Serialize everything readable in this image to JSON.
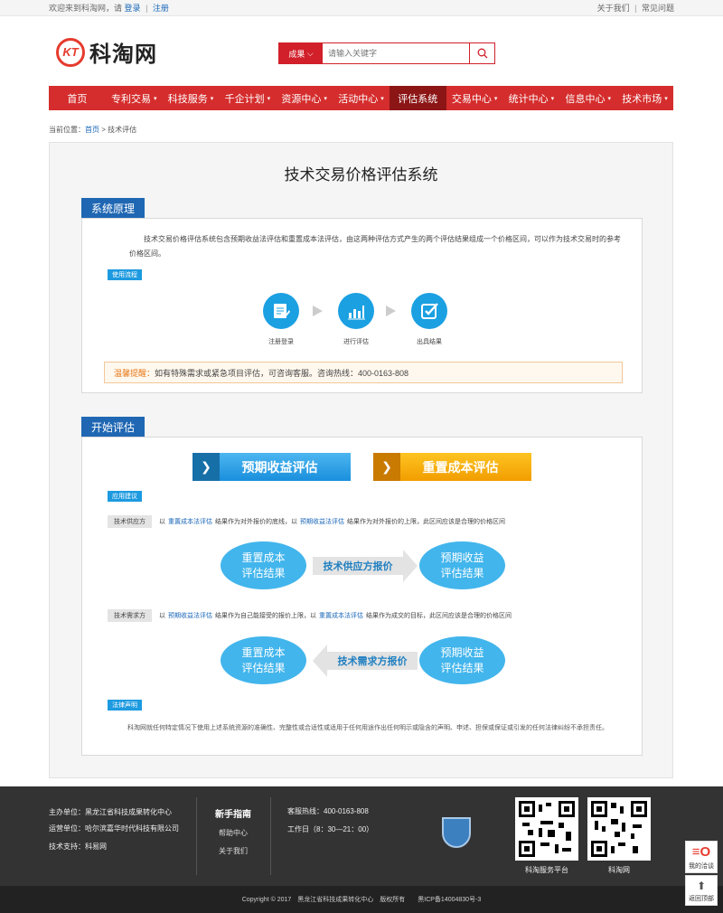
{
  "topbar": {
    "welcome": "欢迎来到科淘网，请",
    "login": "登录",
    "sep": "|",
    "register": "注册",
    "about": "关于我们",
    "faq": "常见问题"
  },
  "logo": {
    "mark": "KT",
    "name": "科淘网"
  },
  "search": {
    "category": "成果",
    "placeholder": "请输入关键字"
  },
  "nav": [
    {
      "label": "首页",
      "caret": false,
      "active": false
    },
    {
      "label": "专利交易",
      "caret": true,
      "active": false
    },
    {
      "label": "科技服务",
      "caret": true,
      "active": false
    },
    {
      "label": "千企计划",
      "caret": true,
      "active": false
    },
    {
      "label": "资源中心",
      "caret": true,
      "active": false
    },
    {
      "label": "活动中心",
      "caret": true,
      "active": false
    },
    {
      "label": "评估系统",
      "caret": false,
      "active": true
    },
    {
      "label": "交易中心",
      "caret": true,
      "active": false
    },
    {
      "label": "统计中心",
      "caret": true,
      "active": false
    },
    {
      "label": "信息中心",
      "caret": true,
      "active": false
    },
    {
      "label": "技术市场",
      "caret": true,
      "active": false
    }
  ],
  "breadcrumb": {
    "prefix": "当前位置：",
    "home": "首页",
    "sep": " > ",
    "current": "技术评估"
  },
  "main": {
    "title": "技术交易价格评估系统",
    "principle": {
      "tab": "系统原理",
      "desc": "技术交易价格评估系统包含预期收益法评估和重置成本法评估，由这两种评估方式产生的两个评估结果组成一个价格区间，可以作为技术交易时的参考价格区间。",
      "flow_tag": "使用流程",
      "steps": [
        {
          "label": "注册登录",
          "icon": "register-icon"
        },
        {
          "label": "进行评估",
          "icon": "bar-chart-icon"
        },
        {
          "label": "出具结果",
          "icon": "checkbox-icon"
        }
      ],
      "tips_key": "温馨提醒：",
      "tips_text": "如有特殊需求或紧急项目评估，可咨询客服。咨询热线：400-0163-808"
    },
    "start": {
      "tab": "开始评估",
      "btn_expected": "预期收益评估",
      "btn_reset": "重置成本评估",
      "advice_tag": "应用建议",
      "supplier": {
        "role": "技术供应方",
        "t1": "以",
        "l1": "重置成本法评估",
        "t2": "结果作为对外报价的底线，以",
        "l2": "预期收益法评估",
        "t3": "结果作为对外报价的上限，此区间应该是合理的价格区间"
      },
      "demander": {
        "role": "技术需求方",
        "t1": "以",
        "l1": "预期收益法评估",
        "t2": "结果作为自己能接受的报价上限，以",
        "l2": "重置成本法评估",
        "t3": "结果作为成交的目标，此区间应该是合理的价格区间"
      },
      "diagram1": {
        "left": [
          "重置成本",
          "评估结果"
        ],
        "arrow": "技术供应方报价",
        "right": [
          "预期收益",
          "评估结果"
        ]
      },
      "diagram2": {
        "left": [
          "重置成本",
          "评估结果"
        ],
        "arrow": "技术需求方报价",
        "right": [
          "预期收益",
          "评估结果"
        ]
      },
      "law_tag": "法律声明",
      "law_text": "科淘网就任何特定情况下使用上述系统资源的准确性、完整性或合适性或适用于任何用途作出任何明示或隐含的声明、申述、担保或保证或引发的任何法律纠纷不承担责任。"
    }
  },
  "footer": {
    "host_label": "主办单位：",
    "host": "黑龙江省科技成果转化中心",
    "operator_label": "运营单位：",
    "operator": "哈尔滨嘉华时代科技有限公司",
    "support_label": "技术支持：",
    "support": "科易网",
    "guide_title": "新手指南",
    "help": "帮助中心",
    "about": "关于我们",
    "hotline": "客服热线：400-0163-808",
    "hours": "工作日（8：30—21：00）",
    "qr1": "科淘服务平台",
    "qr2": "科淘网",
    "copyright": "Copyright © 2017　黑龙江省科技成果转化中心　版权所有　　黑ICP备14004830号-3"
  },
  "side": {
    "consult": "我的洽谈",
    "top": "返回顶部"
  },
  "colors": {
    "brand_red": "#d52d2d",
    "nav_active": "#8c1515",
    "tab_blue": "#1f67b3",
    "accent_blue": "#1ba0e2",
    "orange": "#f29d00"
  }
}
